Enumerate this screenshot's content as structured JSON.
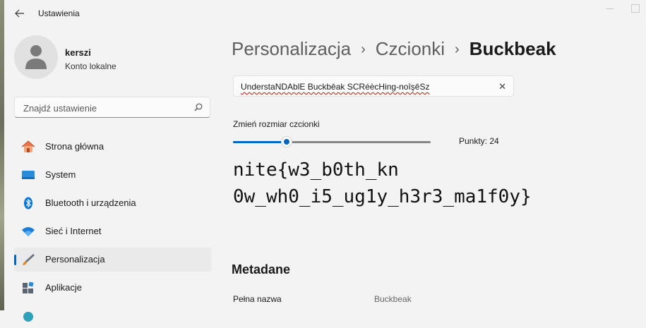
{
  "window": {
    "title": "Ustawienia"
  },
  "profile": {
    "name": "kerszi",
    "account_type": "Konto lokalne"
  },
  "search": {
    "placeholder": "Znajdź ustawienie"
  },
  "nav": [
    {
      "label": "Strona główna",
      "icon": "home-icon",
      "active": false
    },
    {
      "label": "System",
      "icon": "monitor-icon",
      "active": false
    },
    {
      "label": "Bluetooth i urządzenia",
      "icon": "bluetooth-icon",
      "active": false
    },
    {
      "label": "Sieć i Internet",
      "icon": "wifi-icon",
      "active": false
    },
    {
      "label": "Personalizacja",
      "icon": "paintbrush-icon",
      "active": true
    },
    {
      "label": "Aplikacje",
      "icon": "apps-icon",
      "active": false
    }
  ],
  "breadcrumb": {
    "level1": "Personalizacja",
    "level2": "Czcionki",
    "current": "Buckbeak"
  },
  "preview": {
    "text": "UnderstaNDAblE Buckbēak SCRéècHing-noîşēSz"
  },
  "font_size": {
    "label": "Zmień rozmiar czcionki",
    "points_text": "Punkty: 24",
    "value_fraction": 0.27
  },
  "sample": {
    "line1": "nite{w3_b0th_kn",
    "line2": "0w_wh0_i5_ug1y_h3r3_ma1f0y}"
  },
  "metadata": {
    "title": "Metadane",
    "full_name_label": "Pełna nazwa",
    "full_name_value": "Buckbeak"
  },
  "colors": {
    "accent": "#0067c0",
    "background": "#f3f3f3"
  }
}
